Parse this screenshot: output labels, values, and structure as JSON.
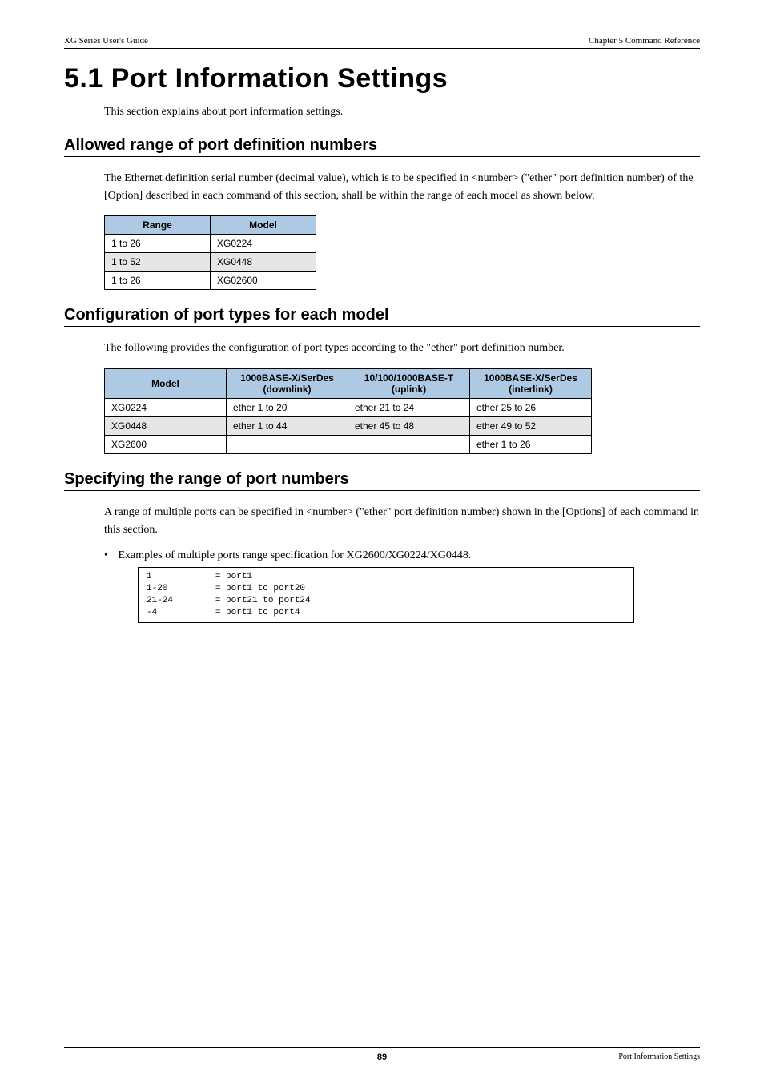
{
  "header": {
    "left": "XG Series User's Guide",
    "right": "Chapter 5 Command Reference"
  },
  "title": "5.1    Port Information Settings",
  "intro": "This section explains about port information settings.",
  "sections": {
    "s1": {
      "heading": "Allowed range of port definition numbers",
      "body": "The Ethernet definition serial number (decimal value), which is to be specified in <number> (\"ether\" port definition number) of the [Option] described in each command of this section, shall be within the range of each model as shown below.",
      "table": {
        "headers": [
          "Range",
          "Model"
        ],
        "rows": [
          [
            "1 to 26",
            "XG0224"
          ],
          [
            "1 to 52",
            "XG0448"
          ],
          [
            "1 to 26",
            "XG02600"
          ]
        ]
      }
    },
    "s2": {
      "heading": "Configuration of port types for each model",
      "body": "The following provides the configuration of port types according to the \"ether\" port definition number.",
      "table": {
        "headers": [
          "Model",
          "1000BASE-X/SerDes (downlink)",
          "10/100/1000BASE-T (uplink)",
          "1000BASE-X/SerDes (interlink)"
        ],
        "rows": [
          [
            "XG0224",
            "ether 1 to 20",
            "ether 21 to 24",
            "ether 25 to 26"
          ],
          [
            "XG0448",
            "ether 1 to 44",
            "ether 45 to 48",
            "ether 49 to 52"
          ],
          [
            "XG2600",
            "",
            "",
            "ether 1 to 26"
          ]
        ]
      }
    },
    "s3": {
      "heading": "Specifying the range of port numbers",
      "body": "A range of multiple ports can be specified in <number> (\"ether\" port definition number) shown in the [Options] of each command in this section.",
      "bullet": "Examples of multiple ports range specification for XG2600/XG0224/XG0448.",
      "code": "1            = port1\n1-20         = port1 to port20\n21-24        = port21 to port24\n-4           = port1 to port4"
    }
  },
  "footer": {
    "page": "89",
    "title": "Port Information Settings"
  }
}
